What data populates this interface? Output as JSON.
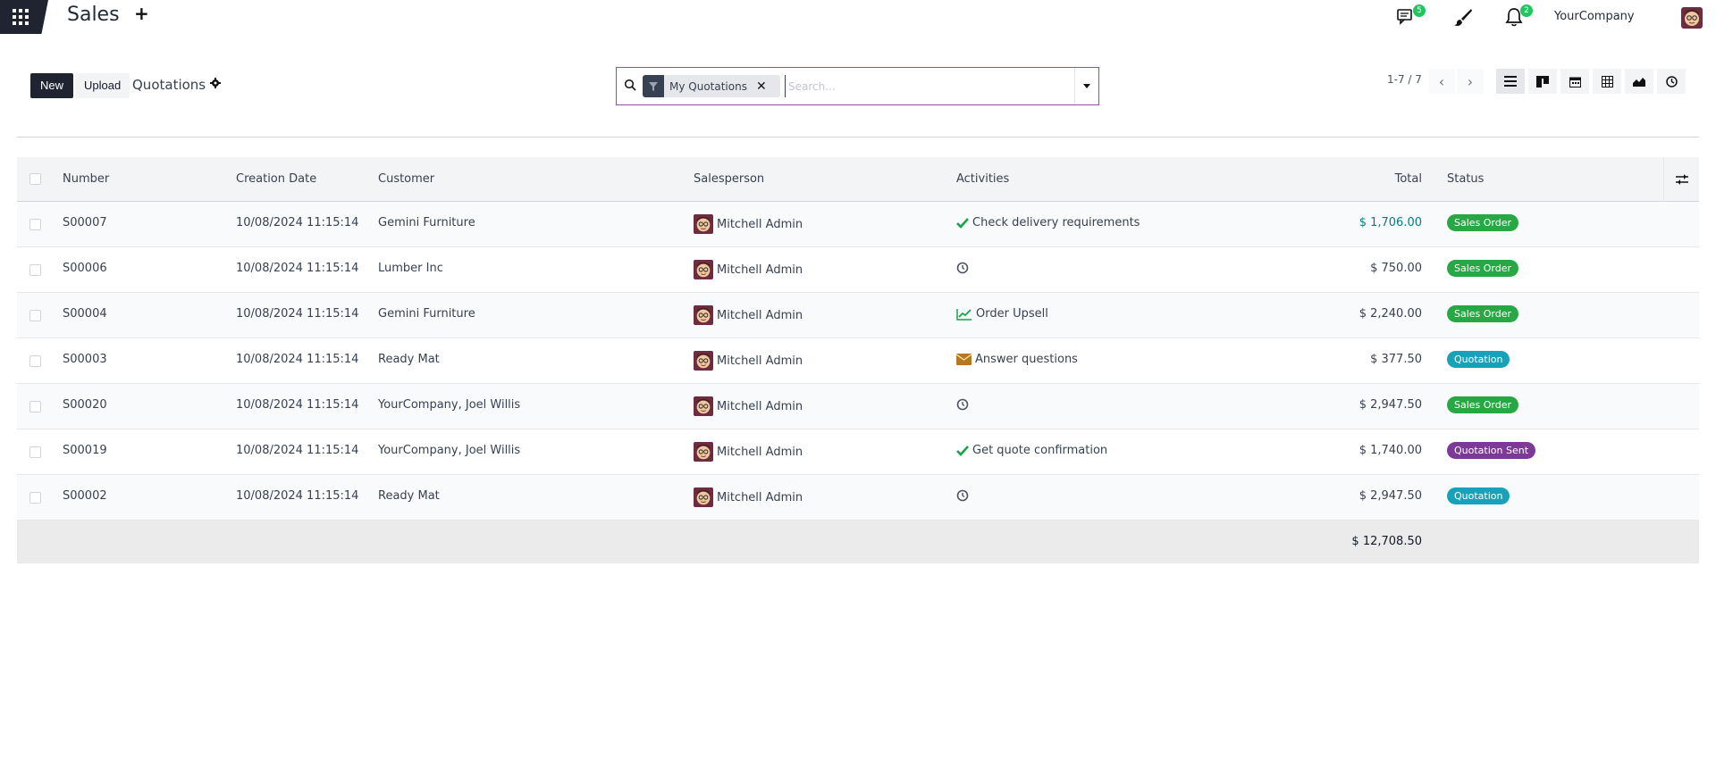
{
  "app": {
    "title": "Sales",
    "company": "YourCompany"
  },
  "navbar": {
    "messages_count": "5",
    "activities_count": "2",
    "icons": [
      "apps-icon",
      "plus-icon",
      "chat-icon",
      "brush-icon",
      "bell-icon",
      "avatar"
    ]
  },
  "control": {
    "new_label": "New",
    "upload_label": "Upload",
    "breadcrumb": "Quotations",
    "search": {
      "facet": "My Quotations",
      "placeholder": "Search..."
    },
    "pager": "1-7 / 7",
    "views": [
      "list-view-icon",
      "kanban-view-icon",
      "calendar-view-icon",
      "pivot-view-icon",
      "graph-view-icon",
      "activity-view-icon"
    ]
  },
  "table": {
    "headers": [
      "Number",
      "Creation Date",
      "Customer",
      "Salesperson",
      "Activities",
      "Total",
      "Status"
    ],
    "rows": [
      {
        "number": "S00007",
        "date": "10/08/2024 11:15:14",
        "customer": "Gemini Furniture",
        "salesperson": "Mitchell Admin",
        "activity_icon": "check-icon",
        "activity": "Check delivery requirements",
        "total": "$ 1,706.00",
        "total_highlight": true,
        "status": "Sales Order",
        "status_color": "#28a745"
      },
      {
        "number": "S00006",
        "date": "10/08/2024 11:15:14",
        "customer": "Lumber Inc",
        "salesperson": "Mitchell Admin",
        "activity_icon": "clock-icon",
        "activity": "",
        "total": "$ 750.00",
        "total_highlight": false,
        "status": "Sales Order",
        "status_color": "#28a745"
      },
      {
        "number": "S00004",
        "date": "10/08/2024 11:15:14",
        "customer": "Gemini Furniture",
        "salesperson": "Mitchell Admin",
        "activity_icon": "chart-up-icon",
        "activity": "Order Upsell",
        "total": "$ 2,240.00",
        "total_highlight": false,
        "status": "Sales Order",
        "status_color": "#28a745"
      },
      {
        "number": "S00003",
        "date": "10/08/2024 11:15:14",
        "customer": "Ready Mat",
        "salesperson": "Mitchell Admin",
        "activity_icon": "envelope-icon",
        "activity": "Answer questions",
        "total": "$ 377.50",
        "total_highlight": false,
        "status": "Quotation",
        "status_color": "#17a2b8"
      },
      {
        "number": "S00020",
        "date": "10/08/2024 11:15:14",
        "customer": "YourCompany, Joel Willis",
        "salesperson": "Mitchell Admin",
        "activity_icon": "clock-icon",
        "activity": "",
        "total": "$ 2,947.50",
        "total_highlight": false,
        "status": "Sales Order",
        "status_color": "#28a745"
      },
      {
        "number": "S00019",
        "date": "10/08/2024 11:15:14",
        "customer": "YourCompany, Joel Willis",
        "salesperson": "Mitchell Admin",
        "activity_icon": "check-icon",
        "activity": "Get quote confirmation",
        "total": "$ 1,740.00",
        "total_highlight": false,
        "status": "Quotation Sent",
        "status_color": "#7c3a96"
      },
      {
        "number": "S00002",
        "date": "10/08/2024 11:15:14",
        "customer": "Ready Mat",
        "salesperson": "Mitchell Admin",
        "activity_icon": "clock-icon",
        "activity": "",
        "total": "$ 2,947.50",
        "total_highlight": false,
        "status": "Quotation",
        "status_color": "#17a2b8"
      }
    ],
    "grand_total": "$ 12,708.50"
  }
}
